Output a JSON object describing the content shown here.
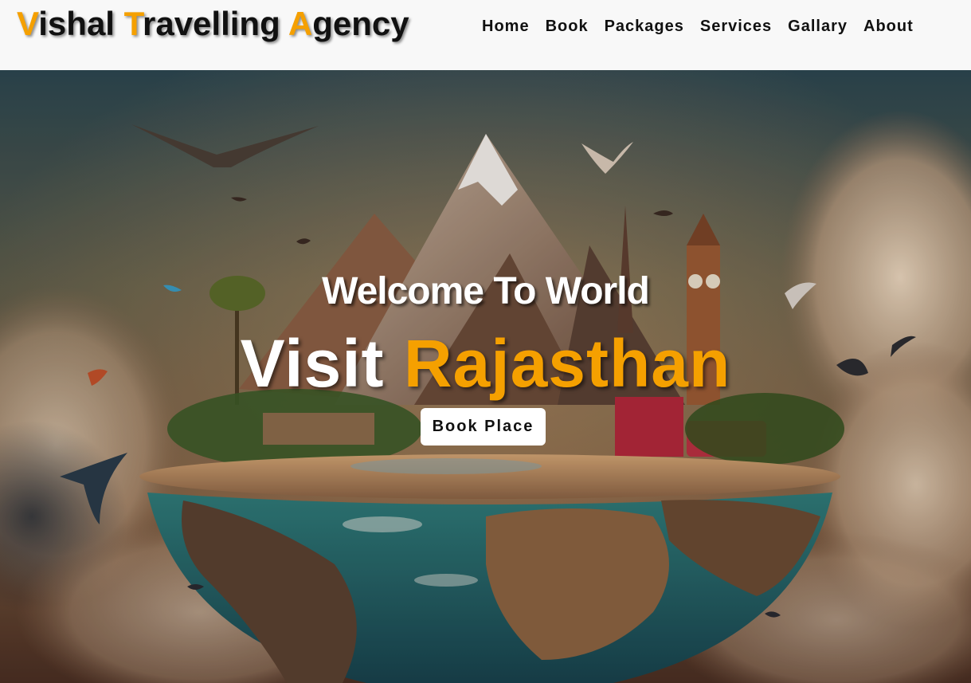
{
  "header": {
    "logo": {
      "word1_initial": "V",
      "word1_rest": "ishal ",
      "word2_initial": "T",
      "word2_rest": "ravelling ",
      "word3_initial": "A",
      "word3_rest": "gency"
    },
    "nav": [
      {
        "label": "Home"
      },
      {
        "label": "Book"
      },
      {
        "label": "Packages"
      },
      {
        "label": "Services"
      },
      {
        "label": "Gallary"
      },
      {
        "label": "About"
      }
    ]
  },
  "hero": {
    "welcome": "Welcome To World",
    "visit_word": "Visit",
    "destination": "Rajasthan",
    "button_label": "Book Place"
  },
  "colors": {
    "accent": "#f5a000",
    "header_bg": "#f8f8f8",
    "text_dark": "#111111"
  }
}
